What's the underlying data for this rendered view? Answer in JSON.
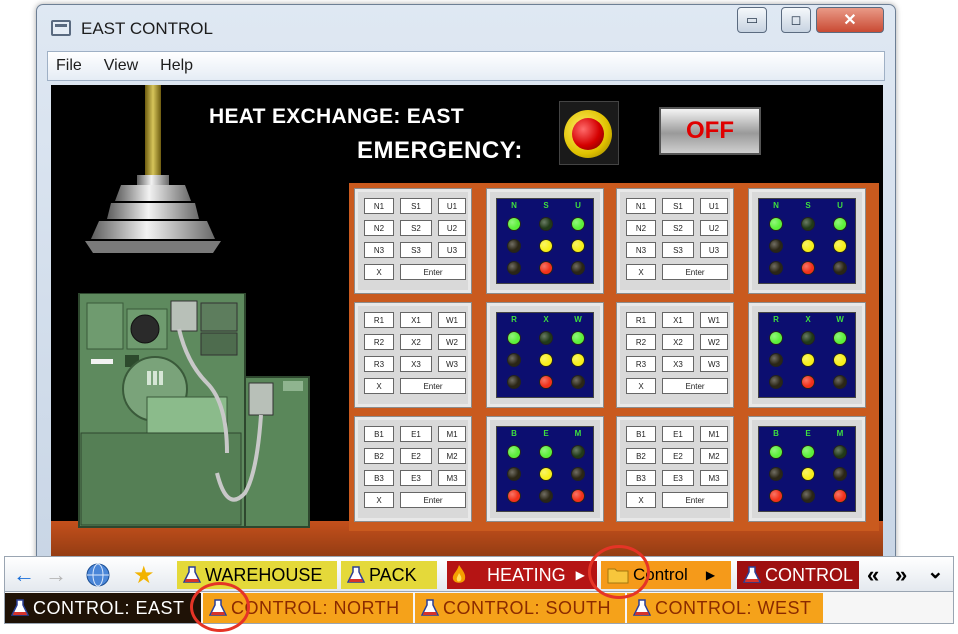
{
  "window": {
    "title": "EAST CONTROL",
    "controls": {
      "minimize": "▭",
      "maximize": "◻",
      "close": "✕"
    }
  },
  "menu": [
    "File",
    "View",
    "Help"
  ],
  "screen": {
    "heading": "HEAT EXCHANGE: EAST",
    "emergency_label": "EMERGENCY:",
    "off_label": "OFF"
  },
  "keypads": [
    {
      "keys": [
        "N1",
        "S1",
        "U1",
        "N2",
        "S2",
        "U2",
        "N3",
        "S3",
        "U3"
      ],
      "clear": "X",
      "enter": "Enter"
    },
    {
      "keys": [
        "N1",
        "S1",
        "U1",
        "N2",
        "S2",
        "U2",
        "N3",
        "S3",
        "U3"
      ],
      "clear": "X",
      "enter": "Enter"
    },
    {
      "keys": [
        "R1",
        "X1",
        "W1",
        "R2",
        "X2",
        "W2",
        "R3",
        "X3",
        "W3"
      ],
      "clear": "X",
      "enter": "Enter"
    },
    {
      "keys": [
        "R1",
        "X1",
        "W1",
        "R2",
        "X2",
        "W2",
        "R3",
        "X3",
        "W3"
      ],
      "clear": "X",
      "enter": "Enter"
    },
    {
      "keys": [
        "B1",
        "E1",
        "M1",
        "B2",
        "E2",
        "M2",
        "B3",
        "E3",
        "M3"
      ],
      "clear": "X",
      "enter": "Enter"
    },
    {
      "keys": [
        "B1",
        "E1",
        "M1",
        "B2",
        "E2",
        "M2",
        "B3",
        "E3",
        "M3"
      ],
      "clear": "X",
      "enter": "Enter"
    }
  ],
  "lamp_panels": [
    {
      "labels": [
        "N",
        "S",
        "U"
      ],
      "rows": [
        [
          "green-on",
          "off",
          "green-on"
        ],
        [
          "off",
          "yellow-on",
          "yellow-on"
        ],
        [
          "off",
          "red-on",
          "off"
        ]
      ]
    },
    {
      "labels": [
        "N",
        "S",
        "U"
      ],
      "rows": [
        [
          "green-on",
          "off",
          "green-on"
        ],
        [
          "off",
          "yellow-on",
          "yellow-on"
        ],
        [
          "off",
          "red-on",
          "off"
        ]
      ]
    },
    {
      "labels": [
        "R",
        "X",
        "W"
      ],
      "rows": [
        [
          "green-on",
          "off",
          "green-on"
        ],
        [
          "off",
          "yellow-on",
          "yellow-on"
        ],
        [
          "off",
          "red-on",
          "off"
        ]
      ]
    },
    {
      "labels": [
        "R",
        "X",
        "W"
      ],
      "rows": [
        [
          "green-on",
          "off",
          "green-on"
        ],
        [
          "off",
          "yellow-on",
          "yellow-on"
        ],
        [
          "off",
          "red-on",
          "off"
        ]
      ]
    },
    {
      "labels": [
        "B",
        "E",
        "M"
      ],
      "rows": [
        [
          "green-on",
          "green-on",
          "off"
        ],
        [
          "off",
          "yellow-on",
          "off"
        ],
        [
          "red-on",
          "off",
          "red-on"
        ]
      ]
    },
    {
      "labels": [
        "B",
        "E",
        "M"
      ],
      "rows": [
        [
          "green-on",
          "green-on",
          "off"
        ],
        [
          "off",
          "yellow-on",
          "off"
        ],
        [
          "red-on",
          "off",
          "red-on"
        ]
      ]
    }
  ],
  "lamp_colors": {
    "green-on": "#5cf03a",
    "yellow-on": "#f7ef1a",
    "red-on": "#f2311a",
    "off-green": "#213a18",
    "off": "#2b2616"
  },
  "toolbar": {
    "back_icon": "←",
    "forward_icon": "→",
    "home_icon": "globe-icon",
    "favorite_icon": "★",
    "warehouse": "WAREHOUSE",
    "pack": "PACK",
    "heating": "HEATING",
    "control_folder": "Control",
    "control": "CONTROL",
    "scroll_left": "«",
    "scroll_right": "»",
    "menu": "⌄"
  },
  "tabs": [
    "CONTROL: EAST",
    "CONTROL: NORTH",
    "CONTROL: SOUTH",
    "CONTROL: WEST"
  ],
  "colors": {
    "warehouse_bg": "#e4d93a",
    "heating_bg": "#b51414",
    "control_folder_bg": "#f59a1a",
    "control_bg": "#9e1010",
    "tab_active_bg": "#1f1206",
    "tab_bg": "#f5a21a",
    "highlight_circle": "#e53426"
  }
}
